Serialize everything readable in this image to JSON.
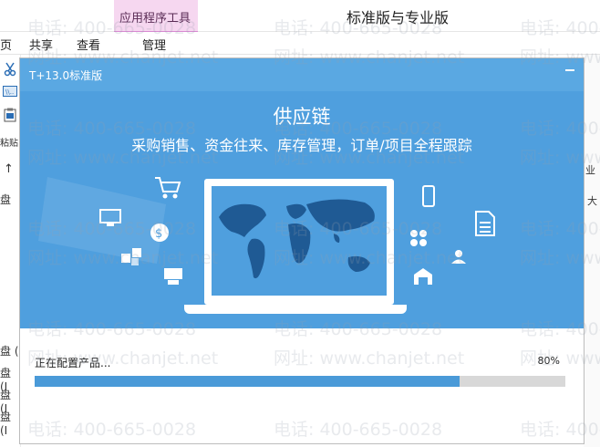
{
  "window": {
    "context_tab_label": "应用程序工具",
    "title": "标准版与专业版",
    "menu": [
      "页",
      "共享",
      "查看",
      "管理"
    ]
  },
  "left_strip": {
    "texts": [
      "粘贴",
      "↑",
      "盘",
      "盘 (",
      "盘 (I",
      "盘 (I",
      "盘 (I"
    ]
  },
  "right_strip": {
    "texts": [
      "业",
      "大"
    ]
  },
  "watermark": {
    "phone": "电话: 400-665-0028",
    "site": "网址: www.chanjet.net"
  },
  "installer": {
    "title": "T+13.0标准版",
    "headline": "供应链",
    "subheadline": "采购销售、资金往来、库存管理，订单/项目全程跟踪",
    "status": "正在配置产品...",
    "progress_label": "80%",
    "progress_fraction": 0.8
  },
  "colors": {
    "hero_blue": "#4f9fde",
    "progress_fill": "#4a9ad8",
    "progress_track": "#d8d8d8",
    "context_tab": "#f6d7f0"
  },
  "icons": [
    "minimize-icon",
    "cart-icon",
    "monitor-icon",
    "dollar-icon",
    "document-icon",
    "phone-icon",
    "box-icon",
    "grid-icon",
    "user-icon",
    "warehouse-icon",
    "scissors-icon",
    "clipboard-icon",
    "world-map-icon"
  ]
}
